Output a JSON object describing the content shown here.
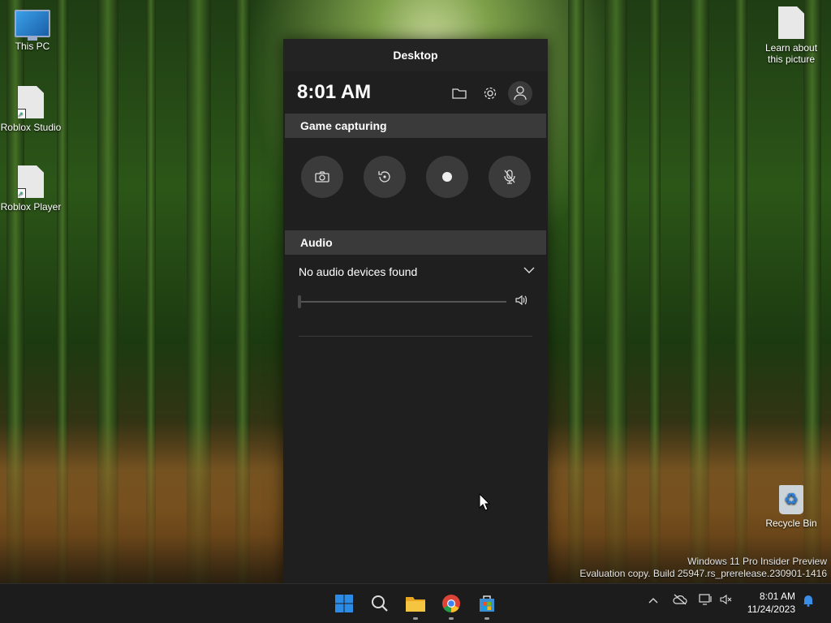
{
  "desktop": {
    "icons": [
      {
        "label": "This PC"
      },
      {
        "label": "Roblox Studio"
      },
      {
        "label": "Roblox Player"
      },
      {
        "label": "Learn about this picture"
      },
      {
        "label": "Recycle Bin"
      }
    ],
    "watermark_line1": "Windows 11 Pro Insider Preview",
    "watermark_line2": "Evaluation copy. Build 25947.rs_prerelease.230901-1416"
  },
  "gamebar": {
    "title": "Desktop",
    "time": "8:01 AM",
    "top_icons": [
      "folder-icon",
      "gear-icon",
      "profile-icon"
    ],
    "capture_section": "Game capturing",
    "capture_buttons": [
      "screenshot",
      "record-last-30s",
      "start-recording",
      "mic-off"
    ],
    "audio_section": "Audio",
    "audio_device": "No audio devices found",
    "volume_percent": 0
  },
  "taskbar": {
    "apps": [
      "start",
      "search",
      "file-explorer",
      "chrome",
      "microsoft-store"
    ],
    "time": "8:01 AM",
    "date": "11/24/2023"
  },
  "colors": {
    "panel_bg": "#1f1f1f",
    "section_bg": "#3a3a3a",
    "taskbar_bg": "#1c1c1c"
  }
}
